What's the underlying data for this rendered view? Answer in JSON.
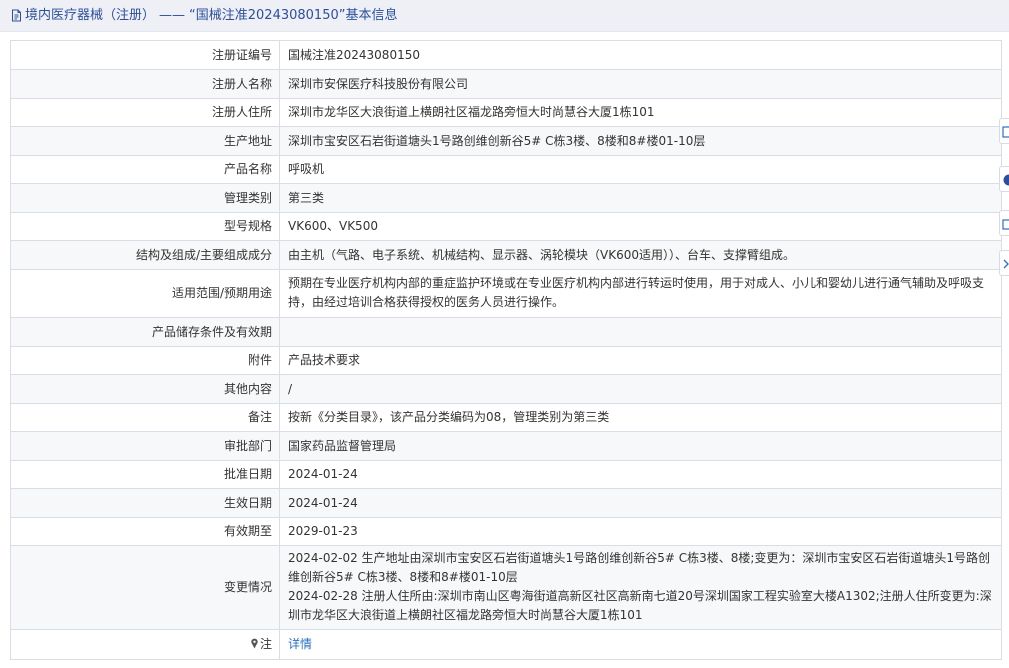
{
  "header": {
    "breadcrumb": "境内医疗器械（注册）",
    "separator": "——",
    "record_title": "“国械注准20243080150”基本信息"
  },
  "rows": [
    {
      "label": "注册证编号",
      "value": "国械注准20243080150"
    },
    {
      "label": "注册人名称",
      "value": "深圳市安保医疗科技股份有限公司"
    },
    {
      "label": "注册人住所",
      "value": "深圳市龙华区大浪街道上横朗社区福龙路旁恒大时尚慧谷大厦1栋101"
    },
    {
      "label": "生产地址",
      "value": "深圳市宝安区石岩街道塘头1号路创维创新谷5# C栋3楼、8楼和8#楼01-10层"
    },
    {
      "label": "产品名称",
      "value": "呼吸机"
    },
    {
      "label": "管理类别",
      "value": "第三类"
    },
    {
      "label": "型号规格",
      "value": "VK600、VK500"
    },
    {
      "label": "结构及组成/主要组成成分",
      "value": "由主机（气路、电子系统、机械结构、显示器、涡轮模块（VK600适用））、台车、支撑臂组成。"
    },
    {
      "label": "适用范围/预期用途",
      "value": "预期在专业医疗机构内部的重症监护环境或在专业医疗机构内部进行转运时使用，用于对成人、小儿和婴幼儿进行通气辅助及呼吸支持，由经过培训合格获得授权的医务人员进行操作。"
    },
    {
      "label": "产品储存条件及有效期",
      "value": ""
    },
    {
      "label": "附件",
      "value": "产品技术要求"
    },
    {
      "label": "其他内容",
      "value": "/"
    },
    {
      "label": "备注",
      "value": "按新《分类目录》，该产品分类编码为08，管理类别为第三类"
    },
    {
      "label": "审批部门",
      "value": "国家药品监督管理局"
    },
    {
      "label": "批准日期",
      "value": "2024-01-24"
    },
    {
      "label": "生效日期",
      "value": "2024-01-24"
    },
    {
      "label": "有效期至",
      "value": "2029-01-23"
    },
    {
      "label": "变更情况",
      "value": "2024-02-02 生产地址由深圳市宝安区石岩街道塘头1号路创维创新谷5# C栋3楼、8楼;变更为：深圳市宝安区石岩街道塘头1号路创维创新谷5# C栋3楼、8楼和8#楼01-10层\n2024-02-28 注册人住所由:深圳市南山区粤海街道高新区社区高新南七道20号深圳国家工程实验室大楼A1302;注册人住所变更为:深圳市龙华区大浪街道上横朗社区福龙路旁恒大时尚慧谷大厦1栋101"
    }
  ],
  "note": {
    "label": "注",
    "link": "详情"
  },
  "colors": {
    "title_text": "#2b4f9e",
    "title_bg": "#eef0f5",
    "border": "#d9dde5",
    "stripe": "#f7f8fa",
    "link": "#2b6fc7"
  },
  "side_toolbar": [
    "edit-icon",
    "help-icon",
    "copy-icon",
    "collapse-icon"
  ]
}
